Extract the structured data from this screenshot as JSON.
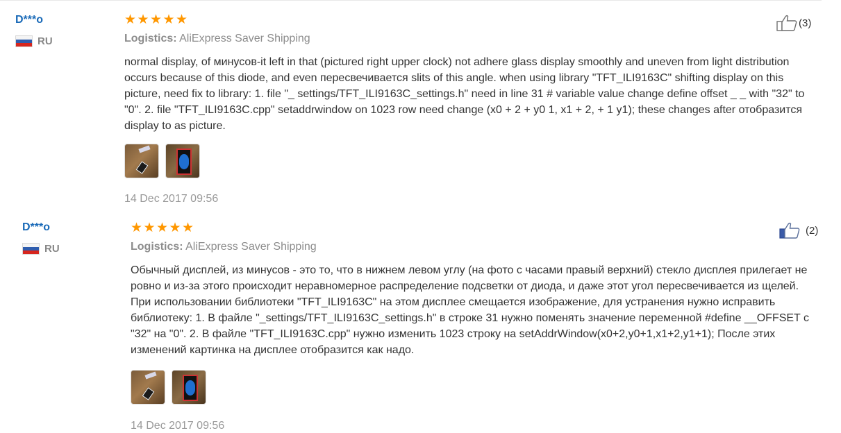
{
  "reviews": [
    {
      "buyer": "D***o",
      "country": "RU",
      "rating": 5,
      "logistics_label": "Logistics:",
      "logistics_value": "AliExpress Saver Shipping",
      "text": "normal display, of минусов-it left in that (pictured right upper clock) not adhere glass display smoothly and uneven from light distribution occurs because of this diode, and even пересвечивается slits of this angle. when using library \"TFT_ILI9163C\" shifting display on this picture, need fix to library: 1. file \"_ settings/TFT_ILI9163C_settings.h\" need in line 31 # variable value change define offset _ _ with \"32\" to \"0\". 2. file \"TFT_ILI9163C.cpp\" setaddrwindow on 1023 row need change (x0 + 2 + y0 1, x1 + 2, + 1 y1); these changes after отобразится display to as picture.",
      "photos": [
        "review-photo-display-parts",
        "review-photo-display-clock"
      ],
      "date": "14 Dec 2017 09:56",
      "helpful_count": "(3)",
      "icons": {
        "like": "thumbs-up-icon",
        "flag": "russia-flag-icon",
        "star": "star-icon"
      }
    },
    {
      "buyer": "D***o",
      "country": "RU",
      "rating": 5,
      "logistics_label": "Logistics:",
      "logistics_value": "AliExpress Saver Shipping",
      "text": "Обычный дисплей, из минусов - это то, что в нижнем левом углу (на фото с часами правый верхний) стекло дисплея прилегает не ровно и из-за этого происходит неравномерное распределение подсветки от диода, и даже этот угол пересвечивается из щелей. При использовании библиотеки \"TFT_ILI9163C\" на этом дисплее смещается изображение, для устранения нужно исправить библиотеку: 1. В файле \"_settings/TFT_ILI9163C_settings.h\" в строке 31 нужно поменять значение переменной #define __OFFSET с \"32\" на \"0\". 2. В файле \"TFT_ILI9163C.cpp\" нужно изменить 1023 строку на setAddrWindow(x0+2,y0+1,x1+2,y1+1); После этих изменений картинка на дисплее отобразится как надо.",
      "photos": [
        "review-photo-display-parts",
        "review-photo-display-clock"
      ],
      "date": "14 Dec 2017 09:56",
      "helpful_count": "(2)",
      "icons": {
        "like": "thumbs-up-icon",
        "flag": "russia-flag-icon",
        "star": "star-icon"
      }
    }
  ],
  "colors": {
    "buyer_name": "#1a6ab8",
    "star": "#ff9700",
    "muted": "#8c8c8c",
    "date": "#999999",
    "text": "#333333"
  }
}
